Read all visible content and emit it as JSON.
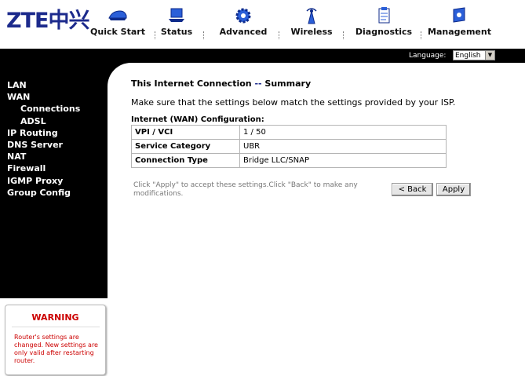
{
  "brand": {
    "logo_latin": "ZTE",
    "logo_chinese": "中兴"
  },
  "nav": [
    {
      "label": "Quick Start",
      "icon": "car-icon"
    },
    {
      "label": "Status",
      "icon": "laptop-icon"
    },
    {
      "label": "Advanced",
      "icon": "gear-icon"
    },
    {
      "label": "Wireless",
      "icon": "antenna-icon"
    },
    {
      "label": "Diagnostics",
      "icon": "clipboard-icon"
    },
    {
      "label": "Management",
      "icon": "monitor-icon"
    }
  ],
  "language": {
    "label": "Language:",
    "selected": "English"
  },
  "sidebar": {
    "items": [
      {
        "label": "LAN"
      },
      {
        "label": "WAN"
      },
      {
        "label": "Connections"
      },
      {
        "label": "ADSL"
      },
      {
        "label": "IP Routing"
      },
      {
        "label": "DNS Server"
      },
      {
        "label": "NAT"
      },
      {
        "label": "Firewall"
      },
      {
        "label": "IGMP Proxy"
      },
      {
        "label": "Group Config"
      }
    ]
  },
  "warning": {
    "title": "WARNING",
    "text": "Router's settings are changed. New settings are only valid after restarting router."
  },
  "main": {
    "title_part1": "This Internet Connection ",
    "title_dash": "--",
    "title_part2": " Summary",
    "instruction": "Make sure that the settings below match the settings provided by your ISP.",
    "config_heading": "Internet (WAN) Configuration:",
    "rows": [
      {
        "key": "VPI / VCI",
        "value": "1 / 50"
      },
      {
        "key": "Service Category",
        "value": "UBR"
      },
      {
        "key": "Connection Type",
        "value": "Bridge LLC/SNAP"
      }
    ],
    "footer_note": "Click \"Apply\" to accept these settings.Click \"Back\" to make any modifications.",
    "back_label": "< Back",
    "apply_label": "Apply"
  },
  "colors": {
    "brand_blue": "#1c2a8c",
    "warning_red": "#cc0000",
    "bar_black": "#000000"
  }
}
